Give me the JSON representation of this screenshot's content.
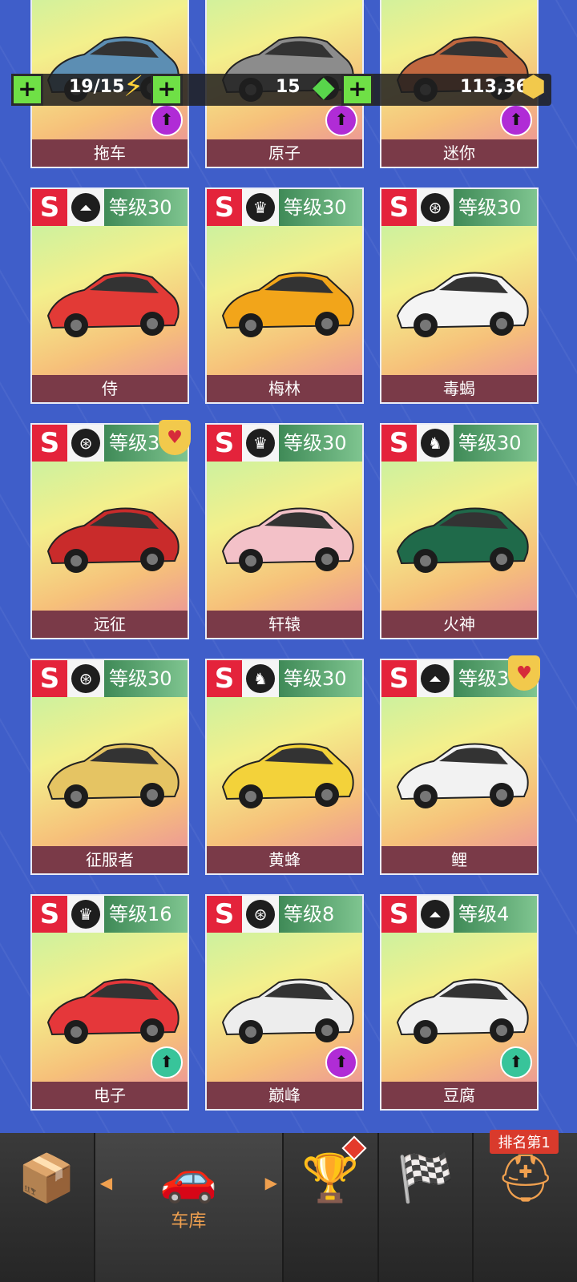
{
  "resources": {
    "energy": "19/15",
    "gems": "15",
    "coins": "113,368",
    "plus_label": "+"
  },
  "cards": [
    {
      "name": "拖车",
      "tier": "",
      "type_icon": "",
      "level": "",
      "car_color": "#5c8eb3",
      "upgrade": "purple"
    },
    {
      "name": "原子",
      "tier": "",
      "type_icon": "",
      "level": "",
      "car_color": "#8c8c8c",
      "upgrade": "purple"
    },
    {
      "name": "迷你",
      "tier": "",
      "type_icon": "",
      "level": "",
      "car_color": "#c0673f",
      "upgrade": "purple"
    },
    {
      "name": "侍",
      "tier": "S",
      "type_icon": "road-icon",
      "level": "等级30",
      "car_color": "#e23a36",
      "upgrade": ""
    },
    {
      "name": "梅林",
      "tier": "S",
      "type_icon": "crown-icon",
      "level": "等级30",
      "car_color": "#f2a51a",
      "upgrade": ""
    },
    {
      "name": "毒蝎",
      "tier": "S",
      "type_icon": "tire-icon",
      "level": "等级30",
      "car_color": "#f4f4f4",
      "upgrade": ""
    },
    {
      "name": "远征",
      "tier": "S",
      "type_icon": "tire-icon",
      "level": "等级30",
      "car_color": "#c92b2b",
      "upgrade": "",
      "favorite": true
    },
    {
      "name": "轩辕",
      "tier": "S",
      "type_icon": "crown-icon",
      "level": "等级30",
      "car_color": "#f3c1c8",
      "upgrade": ""
    },
    {
      "name": "火神",
      "tier": "S",
      "type_icon": "horse-icon",
      "level": "等级30",
      "car_color": "#1f6a4a",
      "upgrade": ""
    },
    {
      "name": "征服者",
      "tier": "S",
      "type_icon": "tire-icon",
      "level": "等级30",
      "car_color": "#e5c463",
      "upgrade": ""
    },
    {
      "name": "黄蜂",
      "tier": "S",
      "type_icon": "horse-icon",
      "level": "等级30",
      "car_color": "#f3d23a",
      "upgrade": ""
    },
    {
      "name": "鲤",
      "tier": "S",
      "type_icon": "road-icon",
      "level": "等级30",
      "car_color": "#f2f2f2",
      "upgrade": "",
      "favorite": true
    },
    {
      "name": "电子",
      "tier": "S",
      "type_icon": "crown-icon",
      "level": "等级16",
      "car_color": "#e5373a",
      "upgrade": "green"
    },
    {
      "name": "巅峰",
      "tier": "S",
      "type_icon": "tire-icon",
      "level": "等级8",
      "car_color": "#ededed",
      "upgrade": "purple"
    },
    {
      "name": "豆腐",
      "tier": "S",
      "type_icon": "road-icon",
      "level": "等级4",
      "car_color": "#f0f0f0",
      "upgrade": "green"
    }
  ],
  "nav": {
    "garage_label": "车库",
    "rank_label": "排名第1"
  }
}
